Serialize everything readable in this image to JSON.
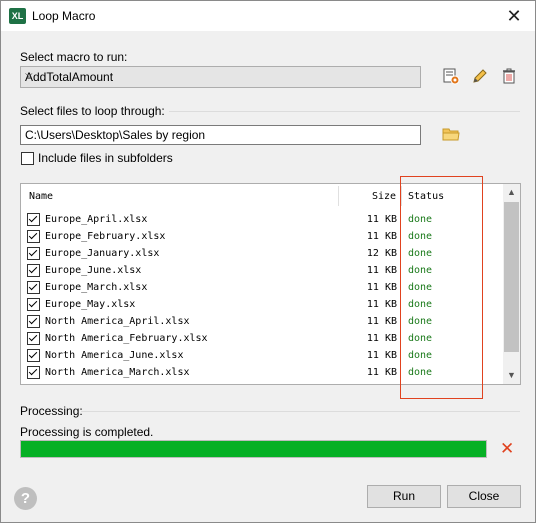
{
  "window": {
    "title": "Loop Macro",
    "app_logo": "XL"
  },
  "macro": {
    "label": "Select macro to run:",
    "selected": "AddTotalAmount",
    "icons": [
      "macro-settings-icon",
      "edit-icon",
      "delete-icon"
    ]
  },
  "files": {
    "label": "Select files to loop through:",
    "path": "C:\\Users\\Desktop\\Sales by region",
    "browse_icon": "folder-icon",
    "include_subfolders_label": "Include files in subfolders",
    "include_subfolders_checked": false
  },
  "table": {
    "headers": {
      "name": "Name",
      "size": "Size",
      "status": "Status"
    },
    "rows": [
      {
        "checked": true,
        "name": "Europe_April.xlsx",
        "size": "11 KB",
        "status": "done"
      },
      {
        "checked": true,
        "name": "Europe_February.xlsx",
        "size": "11 KB",
        "status": "done"
      },
      {
        "checked": true,
        "name": "Europe_January.xlsx",
        "size": "12 KB",
        "status": "done"
      },
      {
        "checked": true,
        "name": "Europe_June.xlsx",
        "size": "11 KB",
        "status": "done"
      },
      {
        "checked": true,
        "name": "Europe_March.xlsx",
        "size": "11 KB",
        "status": "done"
      },
      {
        "checked": true,
        "name": "Europe_May.xlsx",
        "size": "11 KB",
        "status": "done"
      },
      {
        "checked": true,
        "name": "North America_April.xlsx",
        "size": "11 KB",
        "status": "done"
      },
      {
        "checked": true,
        "name": "North America_February.xlsx",
        "size": "11 KB",
        "status": "done"
      },
      {
        "checked": true,
        "name": "North America_June.xlsx",
        "size": "11 KB",
        "status": "done"
      },
      {
        "checked": true,
        "name": "North America_March.xlsx",
        "size": "11 KB",
        "status": "done"
      }
    ]
  },
  "processing": {
    "label": "Processing:",
    "message": "Processing is completed.",
    "progress_percent": 100,
    "progress_color": "#06b025"
  },
  "buttons": {
    "run": "Run",
    "close": "Close",
    "help": "?"
  },
  "colors": {
    "status_done": "#1b7a1b",
    "highlight": "#e0421f"
  }
}
